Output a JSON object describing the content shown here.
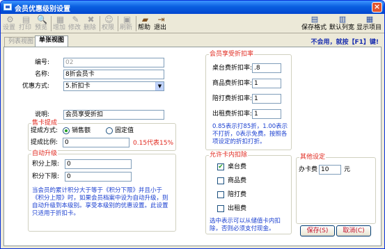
{
  "window": {
    "title": "会员优惠级别设置",
    "close": "×"
  },
  "toolbar": {
    "left": [
      {
        "label": "设置",
        "icon": "gear-icon",
        "glyph": "⚙"
      },
      {
        "label": "打印",
        "icon": "printer-icon",
        "glyph": "▤"
      },
      {
        "label": "预览",
        "icon": "preview-icon",
        "glyph": "🔍"
      },
      {
        "label": "增加",
        "icon": "add-icon",
        "glyph": "▦"
      },
      {
        "label": "修改",
        "icon": "edit-icon",
        "glyph": "✎"
      },
      {
        "label": "删除",
        "icon": "delete-icon",
        "glyph": "✖"
      },
      {
        "label": "权限",
        "icon": "user-icon",
        "glyph": "☺"
      },
      {
        "label": "刷新",
        "icon": "refresh-icon",
        "glyph": "▣"
      },
      {
        "label": "帮助",
        "icon": "help-book-icon",
        "glyph": "▰"
      },
      {
        "label": "退出",
        "icon": "exit-icon",
        "glyph": "⇥"
      }
    ],
    "right": [
      {
        "label": "保存格式",
        "icon": "save-format-icon",
        "glyph": "▤"
      },
      {
        "label": "默认列宽",
        "icon": "column-width-icon",
        "glyph": "▥"
      },
      {
        "label": "显示项目",
        "icon": "display-items-icon",
        "glyph": "▦"
      }
    ]
  },
  "tabs": [
    "列表视图",
    "单张视图"
  ],
  "hint": "不会用，就按【F1】键!",
  "form": {
    "code_label": "编号:",
    "code_value": "02",
    "name_label": "名称:",
    "name_value": "8折会员卡",
    "method_label": "优惠方式:",
    "method_value": "5.折扣卡",
    "desc_label": "说明:",
    "desc_value": "会员享受折扣"
  },
  "commission": {
    "title": "售卡提成",
    "method_label": "提成方式:",
    "opt1": "销售额",
    "opt2": "固定值",
    "ratio_label": "提成比例:",
    "ratio_value": "0",
    "ratio_hint": "0.15代表15%"
  },
  "upgrade": {
    "title": "自动升级",
    "upper_label": "积分上限:",
    "upper_value": "0",
    "lower_label": "积分下限:",
    "lower_value": "0",
    "note": "当会员的累计积分大于等于《积分下限》并且小于《积分上限》时，如果会员档案中设为自动升级，则自动升级到本级别。享受本级别的优惠设置。此设置只适用于折扣卡。"
  },
  "discount": {
    "title": "会员享受折扣率",
    "rows": [
      {
        "label": "桌台费折扣率:",
        "value": ".8"
      },
      {
        "label": "商品费折扣率:",
        "value": "1"
      },
      {
        "label": "陪打费折扣率:",
        "value": "1"
      },
      {
        "label": "出租费折扣率:",
        "value": "1"
      }
    ],
    "note": "0.85表示打85折，1.00表示不打折，0表示免费。按照各项设定的折扣打折。"
  },
  "deduct": {
    "title": "允许卡内扣除",
    "items": [
      {
        "label": "桌台费",
        "checked": true
      },
      {
        "label": "商品费",
        "checked": false
      },
      {
        "label": "陪打费",
        "checked": false
      },
      {
        "label": "出租费",
        "checked": false
      }
    ],
    "note": "选中表示可以从储值卡内扣除，否则必须支付现金。"
  },
  "other": {
    "title": "其他设定",
    "fee_label": "办卡费",
    "fee_value": "10",
    "unit": "元"
  },
  "buttons": {
    "save": "保存(S)",
    "cancel": "取消(C)"
  }
}
